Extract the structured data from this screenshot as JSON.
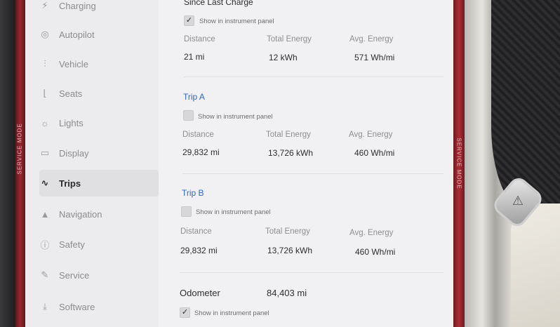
{
  "sidebar": {
    "items": [
      {
        "label": "Charging",
        "icon": "charging-icon",
        "glyph": "⚡"
      },
      {
        "label": "Autopilot",
        "icon": "steering-wheel-icon",
        "glyph": "◎"
      },
      {
        "label": "Vehicle",
        "icon": "vehicle-sliders-icon",
        "glyph": "⫶"
      },
      {
        "label": "Seats",
        "icon": "seat-icon",
        "glyph": "⌊"
      },
      {
        "label": "Lights",
        "icon": "lights-icon",
        "glyph": "☼"
      },
      {
        "label": "Display",
        "icon": "display-icon",
        "glyph": "▭"
      },
      {
        "label": "Trips",
        "icon": "trips-icon",
        "glyph": "∿"
      },
      {
        "label": "Navigation",
        "icon": "navigation-icon",
        "glyph": "▲"
      },
      {
        "label": "Safety",
        "icon": "safety-icon",
        "glyph": "ⓘ"
      },
      {
        "label": "Service",
        "icon": "wrench-icon",
        "glyph": "✎"
      },
      {
        "label": "Software",
        "icon": "download-icon",
        "glyph": "⤓"
      }
    ],
    "active": "Trips"
  },
  "since_last_charge": {
    "title": "Since Last Charge",
    "show_label": "Show in instrument panel",
    "checked": true,
    "headers": [
      "Distance",
      "Total Energy",
      "Avg. Energy"
    ],
    "values": [
      "21 mi",
      "12 kWh",
      "571 Wh/mi"
    ]
  },
  "trip_a": {
    "title": "Trip A",
    "show_label": "Show in instrument panel",
    "checked": false,
    "headers": [
      "Distance",
      "Total Energy",
      "Avg. Energy"
    ],
    "values": [
      "29,832 mi",
      "13,726 kWh",
      "460 Wh/mi"
    ]
  },
  "trip_b": {
    "title": "Trip B",
    "show_label": "Show in instrument panel",
    "checked": false,
    "headers": [
      "Distance",
      "Total Energy",
      "Avg. Energy"
    ],
    "values": [
      "29,832 mi",
      "13,726 kWh",
      "460 Wh/mi"
    ]
  },
  "odometer": {
    "label": "Odometer",
    "value": "84,403 mi",
    "show_label": "Show in instrument panel",
    "checked": true
  },
  "bezel": {
    "left_label": "SERVICE MODE",
    "right_label": "SERVICE MODE"
  },
  "colors": {
    "accent": "#2f66c9",
    "service_red": "#b02a34"
  }
}
